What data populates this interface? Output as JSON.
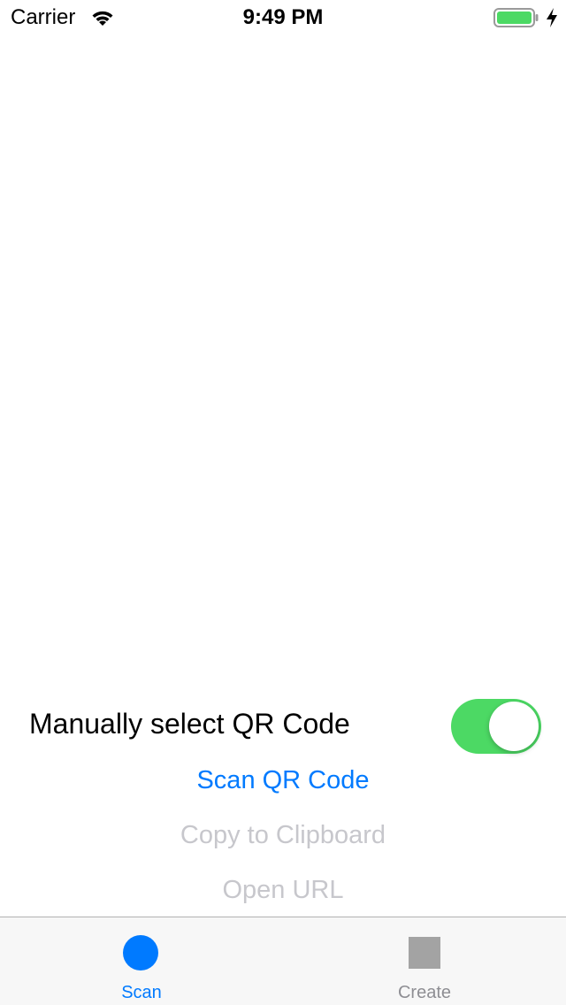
{
  "status_bar": {
    "carrier": "Carrier",
    "time": "9:49 PM",
    "icons": [
      "wifi-icon",
      "battery-icon",
      "charging-bolt-icon"
    ],
    "battery_color": "#4cd964"
  },
  "settings": {
    "manual_select_label": "Manually select QR Code",
    "manual_select_on": true,
    "toggle_on_color": "#4cd964"
  },
  "actions": {
    "scan_label": "Scan QR Code",
    "copy_label": "Copy to Clipboard",
    "open_label": "Open URL",
    "active_color": "#007aff",
    "disabled_color": "#c7c7cc"
  },
  "tab_bar": {
    "tabs": [
      {
        "label": "Scan",
        "icon": "circle-icon",
        "selected": true
      },
      {
        "label": "Create",
        "icon": "square-icon",
        "selected": false
      }
    ]
  }
}
